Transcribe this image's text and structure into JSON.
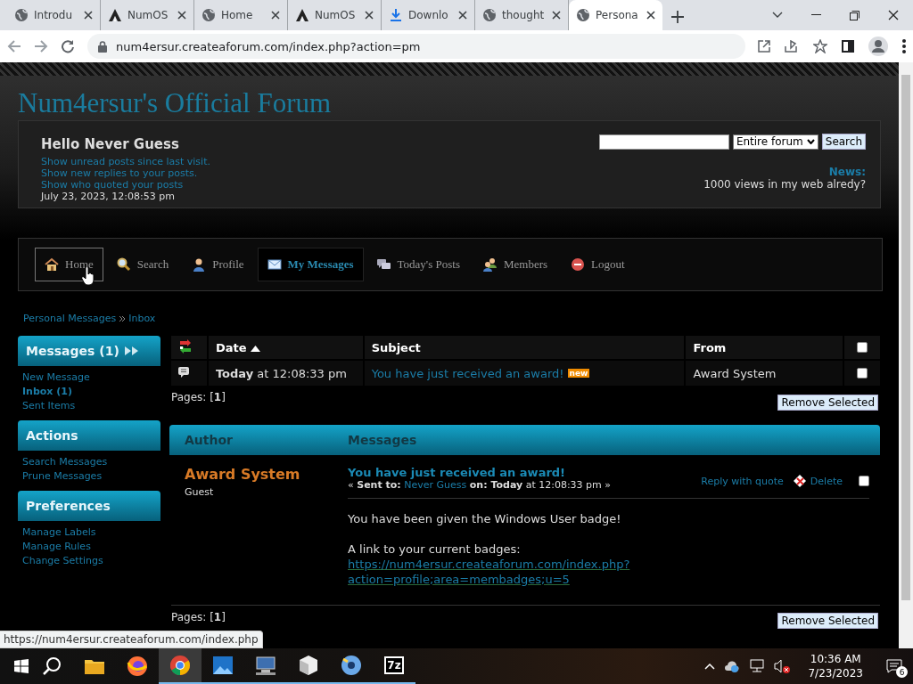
{
  "browser": {
    "tabs": [
      {
        "label": "Introdu",
        "kind": "globe",
        "selected": false
      },
      {
        "label": "NumOS",
        "kind": "logo",
        "selected": false
      },
      {
        "label": "Home",
        "kind": "globe",
        "selected": false
      },
      {
        "label": "NumOS",
        "kind": "logo",
        "selected": false
      },
      {
        "label": "Downlo",
        "kind": "download",
        "selected": false
      },
      {
        "label": "thought",
        "kind": "globe",
        "selected": false
      },
      {
        "label": "Persona",
        "kind": "globe",
        "selected": true
      }
    ],
    "url": "num4ersur.createaforum.com/index.php?action=pm"
  },
  "forum": {
    "title": "Num4ersur's Official Forum",
    "greeting": "Hello Never Guess",
    "links": [
      "Show unread posts since last visit.",
      "Show new replies to your posts.",
      "Show who quoted your posts"
    ],
    "date": "July 23, 2023, 12:08:53 pm",
    "search_scope": "Entire forum",
    "search_button": "Search",
    "news_label": "News:",
    "news": "1000 views in my web alredy?"
  },
  "nav": [
    {
      "label": "Home",
      "kind": "home",
      "selected": false,
      "hovered": true
    },
    {
      "label": "Search",
      "kind": "search",
      "selected": false,
      "hovered": false
    },
    {
      "label": "Profile",
      "kind": "profile",
      "selected": false,
      "hovered": false
    },
    {
      "label": "My Messages",
      "kind": "messages",
      "selected": true,
      "hovered": false
    },
    {
      "label": "Today's Posts",
      "kind": "posts",
      "selected": false,
      "hovered": false
    },
    {
      "label": "Members",
      "kind": "members",
      "selected": false,
      "hovered": false
    },
    {
      "label": "Logout",
      "kind": "logout",
      "selected": false,
      "hovered": false
    }
  ],
  "breadcrumb": [
    "Personal Messages",
    "Inbox"
  ],
  "sidebar": [
    {
      "title": "Messages (1)",
      "has_toggle": true,
      "items": [
        {
          "label": "New Message",
          "selected": false
        },
        {
          "label": "Inbox (1)",
          "selected": true
        },
        {
          "label": "Sent Items",
          "selected": false
        }
      ]
    },
    {
      "title": "Actions",
      "has_toggle": false,
      "items": [
        {
          "label": "Search Messages",
          "selected": false
        },
        {
          "label": "Prune Messages",
          "selected": false
        }
      ]
    },
    {
      "title": "Preferences",
      "has_toggle": false,
      "items": [
        {
          "label": "Manage Labels",
          "selected": false
        },
        {
          "label": "Manage Rules",
          "selected": false
        },
        {
          "label": "Change Settings",
          "selected": false
        }
      ]
    }
  ],
  "inbox": {
    "columns": [
      {
        "label": "Date",
        "sorted": true
      },
      {
        "label": "Subject",
        "sorted": false
      },
      {
        "label": "From",
        "sorted": false
      }
    ],
    "all_checked": false,
    "rows": [
      {
        "date": "**Today** at 12:08:33 pm",
        "subject": "You have just received an award!",
        "badge": "new",
        "from": "Award System",
        "checked": false
      }
    ],
    "pages": "Pages: [**1**]",
    "remove_button": "Remove Selected"
  },
  "message": {
    "columns": [
      "Author",
      "Messages"
    ],
    "author": "Award System",
    "role": "Guest",
    "subject": "You have just received an award!",
    "sent_prefix": "« **Sent to:**",
    "recipient": "Never Guess",
    "sent_suffix": "**on: Today** at 12:08:33 pm »",
    "actions": [
      "Reply with quote",
      "Delete"
    ],
    "checked": false,
    "body": "You have been given the Windows User badge!",
    "link_label": "A link to your current badges:",
    "link": "https://num4ersur.createaforum.com/index.php?action=profile;area=membadges;u=5",
    "pages": "Pages: [**1**]",
    "remove_button": "Remove Selected"
  },
  "status_url": "https://num4ersur.createaforum.com/index.php",
  "taskbar": {
    "apps": [
      {
        "kind": "explorer",
        "running": false
      },
      {
        "kind": "firefox",
        "running": false
      },
      {
        "kind": "chrome",
        "running": true
      },
      {
        "kind": "photos",
        "running": true
      },
      {
        "kind": "computer",
        "running": true
      },
      {
        "kind": "box",
        "running": true
      },
      {
        "kind": "disc",
        "running": true
      },
      {
        "kind": "archiver",
        "label": "7z",
        "running": true
      }
    ],
    "time": "10:36 AM",
    "date": "7/23/2023",
    "notifications": "6"
  }
}
